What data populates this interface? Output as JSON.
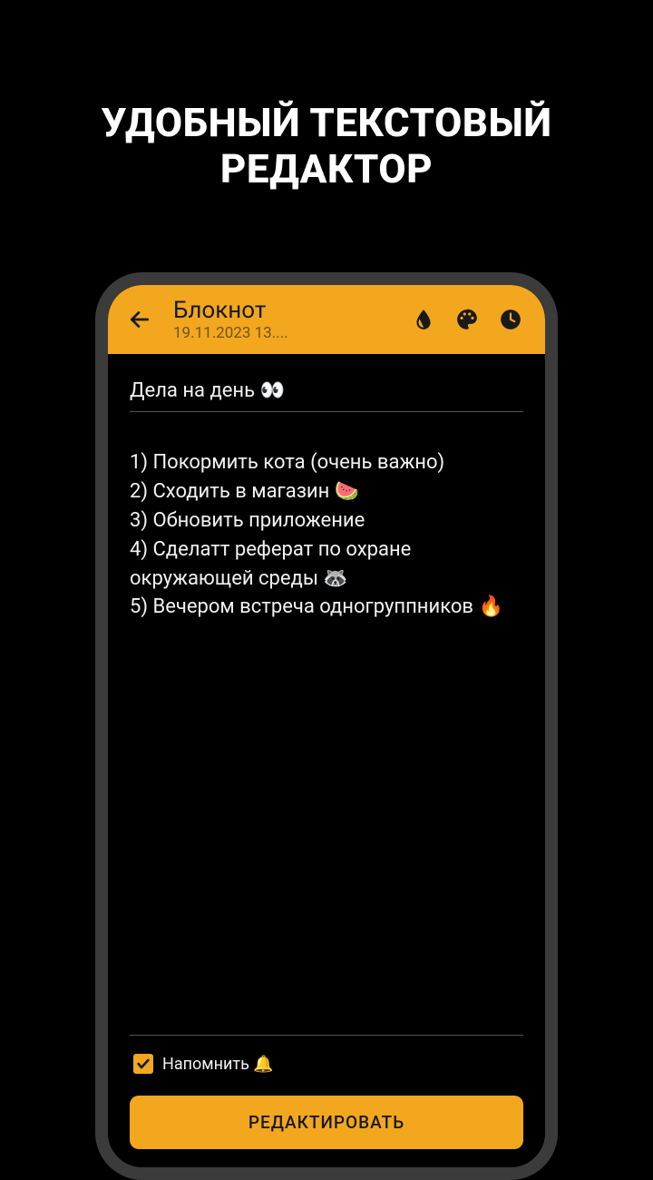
{
  "promo": {
    "line1": "УДОБНЫЙ ТЕКСТОВЫЙ",
    "line2": "РЕДАКТОР"
  },
  "appbar": {
    "title": "Блокнот",
    "subtitle": "19.11.2023 13...."
  },
  "note": {
    "title": "Дела на день 👀",
    "body": "1) Покормить кота (очень важно)\n2) Сходить в магазин 🍉\n3) Обновить приложение\n4) Сделатт реферат по охране окружающей среды 🦝\n5) Вечером встреча одногруппников 🔥"
  },
  "footer": {
    "remind_label": "Напомнить 🔔",
    "edit_button": "РЕДАКТИРОВАТЬ"
  }
}
